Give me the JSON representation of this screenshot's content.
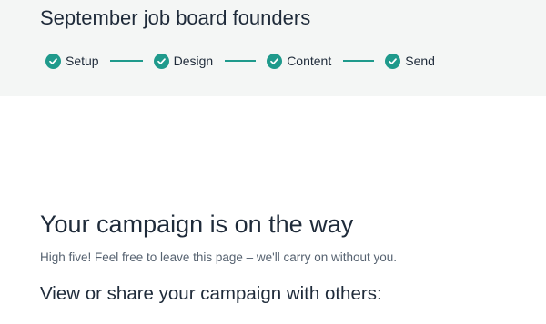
{
  "header": {
    "campaign_title": "September job board founders",
    "steps": [
      {
        "label": "Setup",
        "status": "complete",
        "icon": "check-circle-icon"
      },
      {
        "label": "Design",
        "status": "complete",
        "icon": "check-circle-icon"
      },
      {
        "label": "Content",
        "status": "complete",
        "icon": "check-circle-icon"
      },
      {
        "label": "Send",
        "status": "complete",
        "icon": "check-circle-icon"
      }
    ]
  },
  "main": {
    "heading": "Your campaign is on the way",
    "subtitle": "High five! Feel free to leave this page – we'll carry on without you.",
    "share_heading": "View or share your campaign with others:"
  },
  "colors": {
    "accent": "#1f9a8c",
    "header_bg": "#f4f6f5",
    "text": "#1f2b3a",
    "muted_text": "#566270"
  }
}
